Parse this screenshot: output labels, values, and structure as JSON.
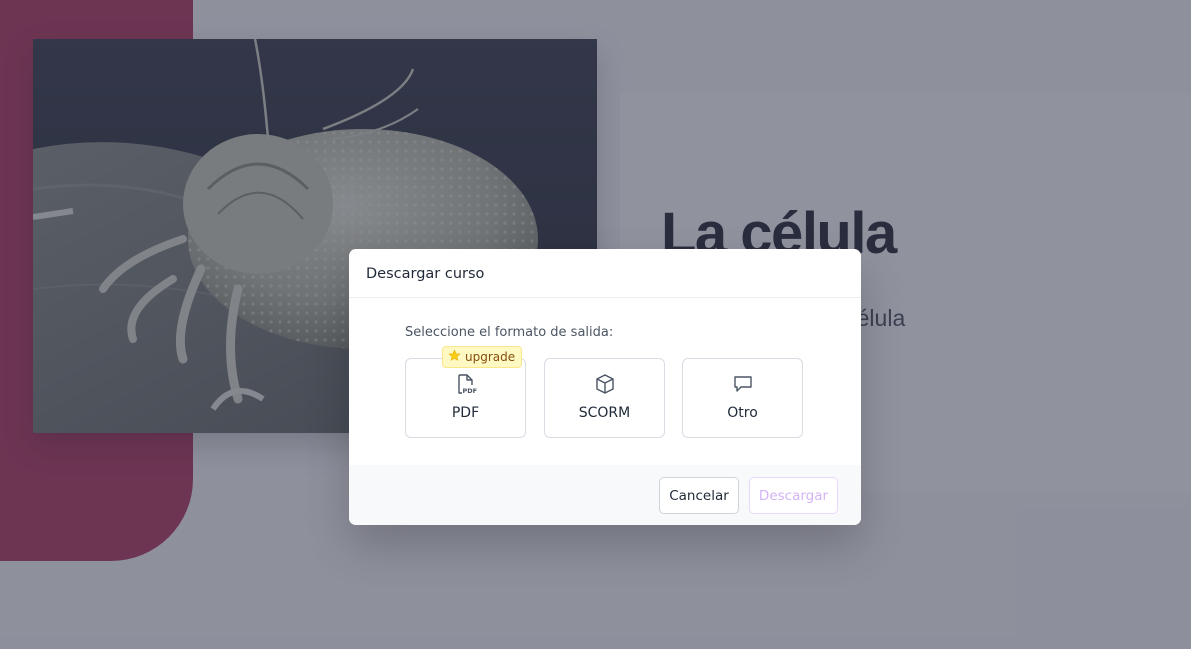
{
  "slide": {
    "title": "La célula",
    "subtitle_visible": "ante mundo de la célula",
    "image": {
      "subject": "mite-micrograph",
      "icon": "mite-image"
    },
    "colors": {
      "accent": "#b23e63",
      "panel": "#f9fafb",
      "overlay": "rgba(39,43,66,0.50)"
    }
  },
  "modal": {
    "title": "Descargar curso",
    "format_prompt": "Seleccione el formato de salida:",
    "upgrade_badge": {
      "label": "upgrade",
      "icon": "star-icon",
      "color": "#facc15"
    },
    "options": [
      {
        "label": "PDF",
        "icon": "pdf-file-icon",
        "selected": false
      },
      {
        "label": "SCORM",
        "icon": "cube-icon",
        "selected": false
      },
      {
        "label": "Otro",
        "icon": "speech-bubble-icon",
        "selected": false
      }
    ],
    "buttons": {
      "cancel": "Cancelar",
      "download": "Descargar",
      "download_disabled": true
    }
  }
}
